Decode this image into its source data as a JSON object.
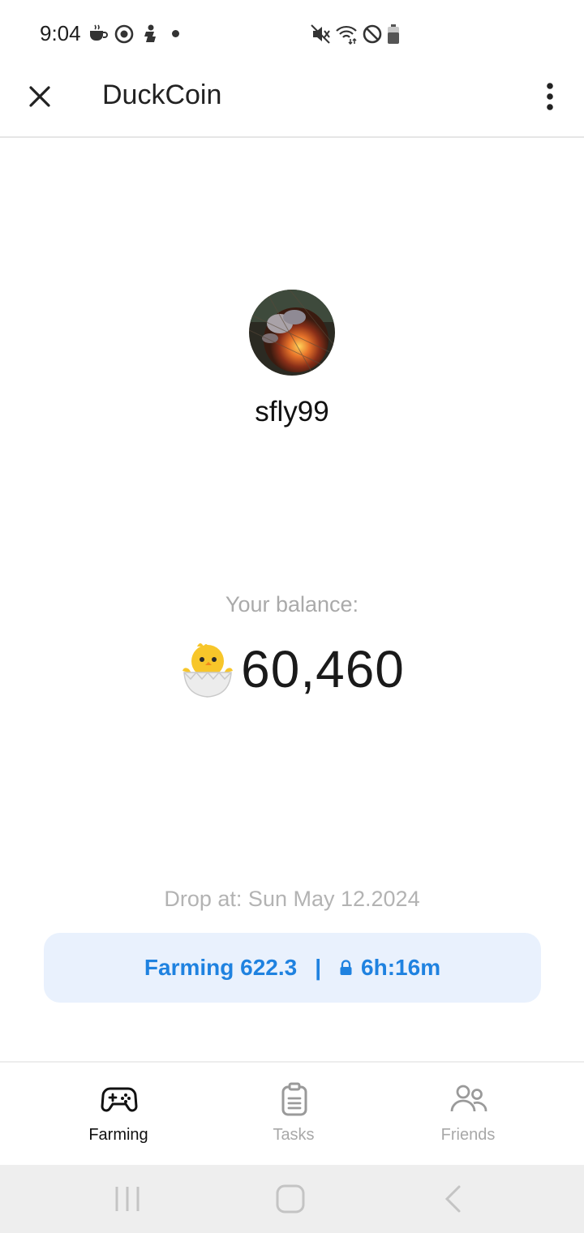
{
  "status_bar": {
    "time": "9:04",
    "left_icons": [
      "coffee-icon",
      "target-icon",
      "figure-icon"
    ],
    "right_icons": [
      "mute-icon",
      "wifi-icon",
      "blocked-icon",
      "battery-icon"
    ]
  },
  "header": {
    "title": "DuckCoin",
    "close_icon": "close-icon",
    "menu_icon": "more-vert-icon"
  },
  "profile": {
    "username": "sfly99"
  },
  "balance": {
    "label": "Your balance:",
    "value": "60,460",
    "icon": "hatching-chick-icon"
  },
  "drop": {
    "text": "Drop at: Sun May 12.2024"
  },
  "farming": {
    "label": "Farming 622.3",
    "separator": "|",
    "timer": "6h:16m",
    "color": "#1f82e0",
    "bg": "#e9f1fd"
  },
  "nav": {
    "items": [
      {
        "label": "Farming",
        "icon": "gamepad-icon",
        "active": true
      },
      {
        "label": "Tasks",
        "icon": "clipboard-icon",
        "active": false
      },
      {
        "label": "Friends",
        "icon": "people-icon",
        "active": false
      }
    ]
  },
  "system_nav": [
    "recents-icon",
    "home-icon",
    "back-icon"
  ]
}
